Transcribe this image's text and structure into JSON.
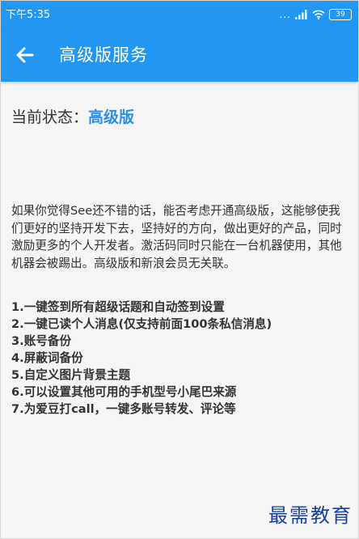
{
  "statusbar": {
    "time": "下午5:35",
    "dots": "...",
    "signal_icon": "signal-icon",
    "wifi_icon": "wifi-icon",
    "battery": "39"
  },
  "appbar": {
    "back_icon": "arrow-left-icon",
    "title": "高级版服务"
  },
  "status": {
    "label": "当前状态：",
    "value": "高级版",
    "value_color": "#2a8fe3"
  },
  "description": "如果你觉得See还不错的话，能否考虑开通高级版，这能够使我们更好的坚持开发下去，坚持好的方向，做出更好的产品，同时激励更多的个人开发者。激活码同时只能在一台机器使用，其他机器会被踢出。高级版和新浪会员无关联。",
  "features": [
    "1.一键签到所有超级话题和自动签到设置",
    "2.一键已读个人消息(仅支持前面100条私信消息)",
    "3.账号备份",
    "4.屏蔽词备份",
    "5.自定义图片背景主题",
    "6.可以设置其他可用的手机型号小尾巴来源",
    "7.为爱豆打call，一键多账号转发、评论等"
  ],
  "watermark": "最需教育",
  "colors": {
    "primary": "#2196f3",
    "background": "#f5f5f5",
    "text": "#333333"
  }
}
